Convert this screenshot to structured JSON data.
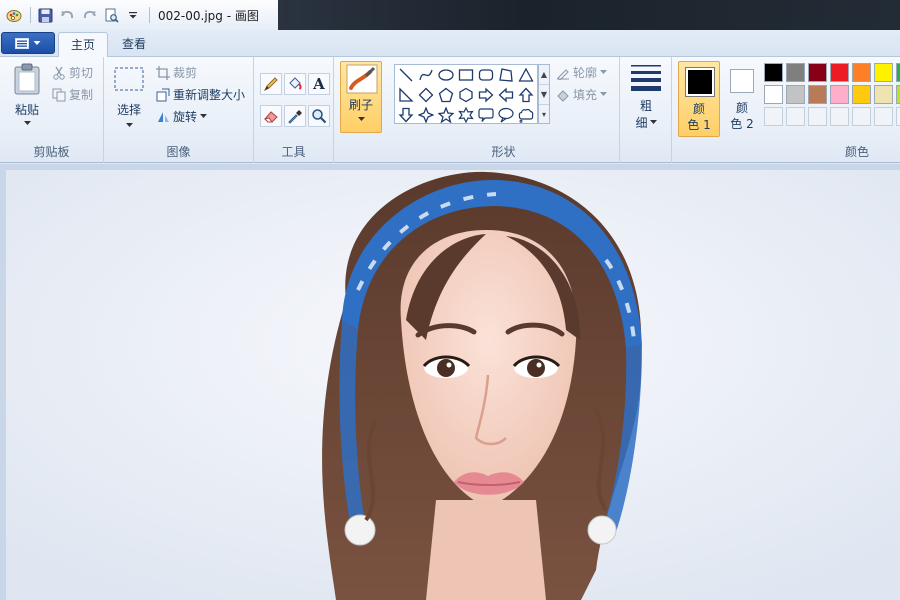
{
  "window": {
    "title": "002-00.jpg - 画图"
  },
  "quick_access": {
    "icons": [
      "paint-app-icon",
      "save-icon",
      "undo-icon",
      "redo-icon",
      "print-preview-icon",
      "customize-dropdown-icon"
    ]
  },
  "tabs": [
    {
      "label": "主页",
      "active": true
    },
    {
      "label": "查看",
      "active": false
    }
  ],
  "ribbon": {
    "clipboard": {
      "paste": "粘贴",
      "cut": "剪切",
      "copy": "复制",
      "group": "剪贴板"
    },
    "image": {
      "select": "选择",
      "crop": "裁剪",
      "resize": "重新调整大小",
      "rotate": "旋转",
      "group": "图像"
    },
    "tools": {
      "group": "工具",
      "items": [
        "pencil-icon",
        "fill-icon",
        "text-icon",
        "eraser-icon",
        "color-picker-icon",
        "magnifier-icon"
      ]
    },
    "brush": {
      "label": "刷子"
    },
    "shapes": {
      "outline": "轮廓",
      "fill": "填充",
      "group": "形状"
    },
    "size": {
      "label_line1": "粗",
      "label_line2": "细"
    },
    "colors": {
      "color1_line1": "颜",
      "color1_line2": "色 1",
      "color2_line1": "颜",
      "color2_line2": "色 2",
      "group": "颜色",
      "color1": "#000000",
      "color2": "#ffffff",
      "palette_row1": [
        "#000000",
        "#7f7f7f",
        "#880015",
        "#ed1c24",
        "#ff7f27",
        "#fff200",
        "#22b14c"
      ],
      "palette_row2": [
        "#ffffff",
        "#c3c3c3",
        "#b97a57",
        "#ffaec9",
        "#ffc90e",
        "#efe4b0",
        "#b5e61d"
      ]
    }
  }
}
